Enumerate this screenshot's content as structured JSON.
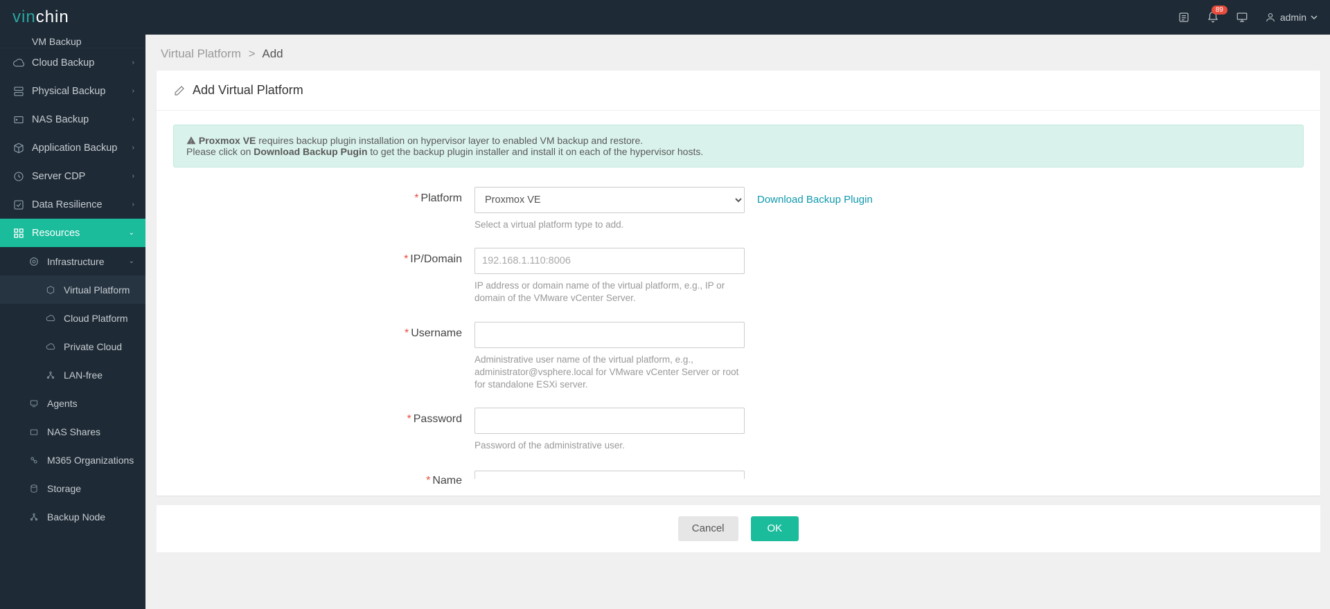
{
  "brand": {
    "pre": "vin",
    "post": "chin"
  },
  "header": {
    "badge": "89",
    "user": "admin"
  },
  "sidebar": {
    "vmbackup": "VM Backup",
    "items": [
      {
        "label": "Cloud Backup"
      },
      {
        "label": "Physical Backup"
      },
      {
        "label": "NAS Backup"
      },
      {
        "label": "Application Backup"
      },
      {
        "label": "Server CDP"
      },
      {
        "label": "Data Resilience"
      }
    ],
    "resources": "Resources",
    "infrastructure": "Infrastructure",
    "infra_children": [
      {
        "label": "Virtual Platform"
      },
      {
        "label": "Cloud Platform"
      },
      {
        "label": "Private Cloud"
      },
      {
        "label": "LAN-free"
      }
    ],
    "tail": [
      {
        "label": "Agents"
      },
      {
        "label": "NAS Shares"
      },
      {
        "label": "M365 Organizations"
      },
      {
        "label": "Storage"
      },
      {
        "label": "Backup Node"
      }
    ]
  },
  "breadcrumb": {
    "a": "Virtual Platform",
    "b": "Add"
  },
  "card": {
    "title": "Add Virtual Platform"
  },
  "alert": {
    "strong1": "Proxmox VE",
    "text1": " requires backup plugin installation on hypervisor layer to enabled VM backup and restore.",
    "text2a": "Please click on ",
    "strong2": "Download Backup Pugin",
    "text2b": " to get the backup plugin installer and install it on each of the hypervisor hosts."
  },
  "form": {
    "platform": {
      "label": "Platform",
      "value": "Proxmox VE",
      "hint": "Select a virtual platform type to add.",
      "link": "Download Backup Plugin"
    },
    "ip": {
      "label": "IP/Domain",
      "placeholder": "192.168.1.110:8006",
      "hint": "IP address or domain name of the virtual platform, e.g., IP or domain of the VMware vCenter Server."
    },
    "user": {
      "label": "Username",
      "hint": "Administrative user name of the virtual platform, e.g., administrator@vsphere.local for VMware vCenter Server or root for standalone ESXi server."
    },
    "pass": {
      "label": "Password",
      "hint": "Password of the administrative user."
    },
    "name": {
      "label": "Name"
    }
  },
  "buttons": {
    "cancel": "Cancel",
    "ok": "OK"
  }
}
